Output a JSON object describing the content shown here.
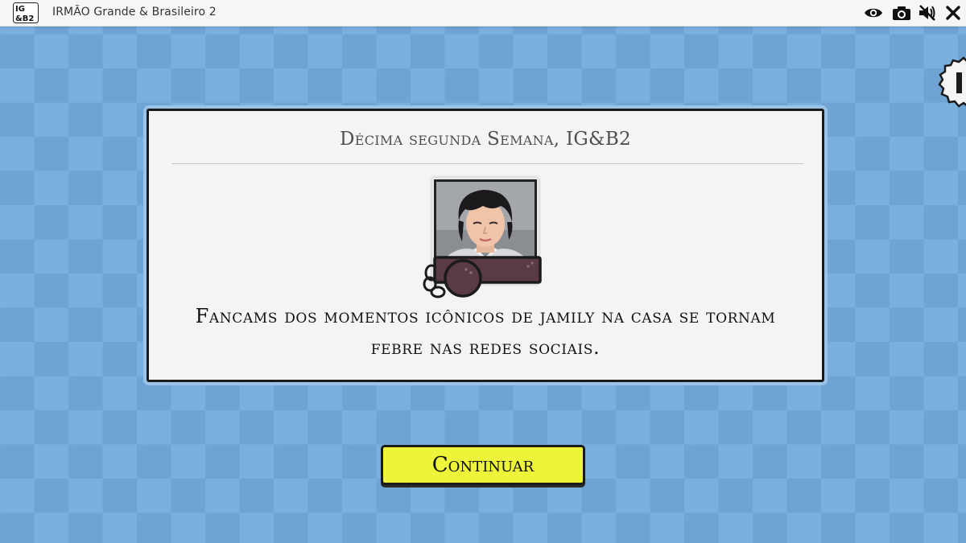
{
  "window": {
    "title": "IRMÃO Grande & Brasileiro 2",
    "logo_text": "IG&B2"
  },
  "toolbar": {
    "icons": [
      "eye-icon",
      "camera-icon",
      "speaker-muted-icon",
      "close-icon"
    ]
  },
  "card": {
    "title": "Décima segunda Semana, IG&B2",
    "message": "Fancams dos momentos icônicos de jamily na casa se tornam febre nas redes sociais."
  },
  "actions": {
    "continue_label": "Continuar"
  },
  "colors": {
    "background_light": "#7ab0de",
    "background_dark": "#6fa3d3",
    "card": "#f4f4f4",
    "button": "#eef43a",
    "shackle": "#5a3a45"
  }
}
